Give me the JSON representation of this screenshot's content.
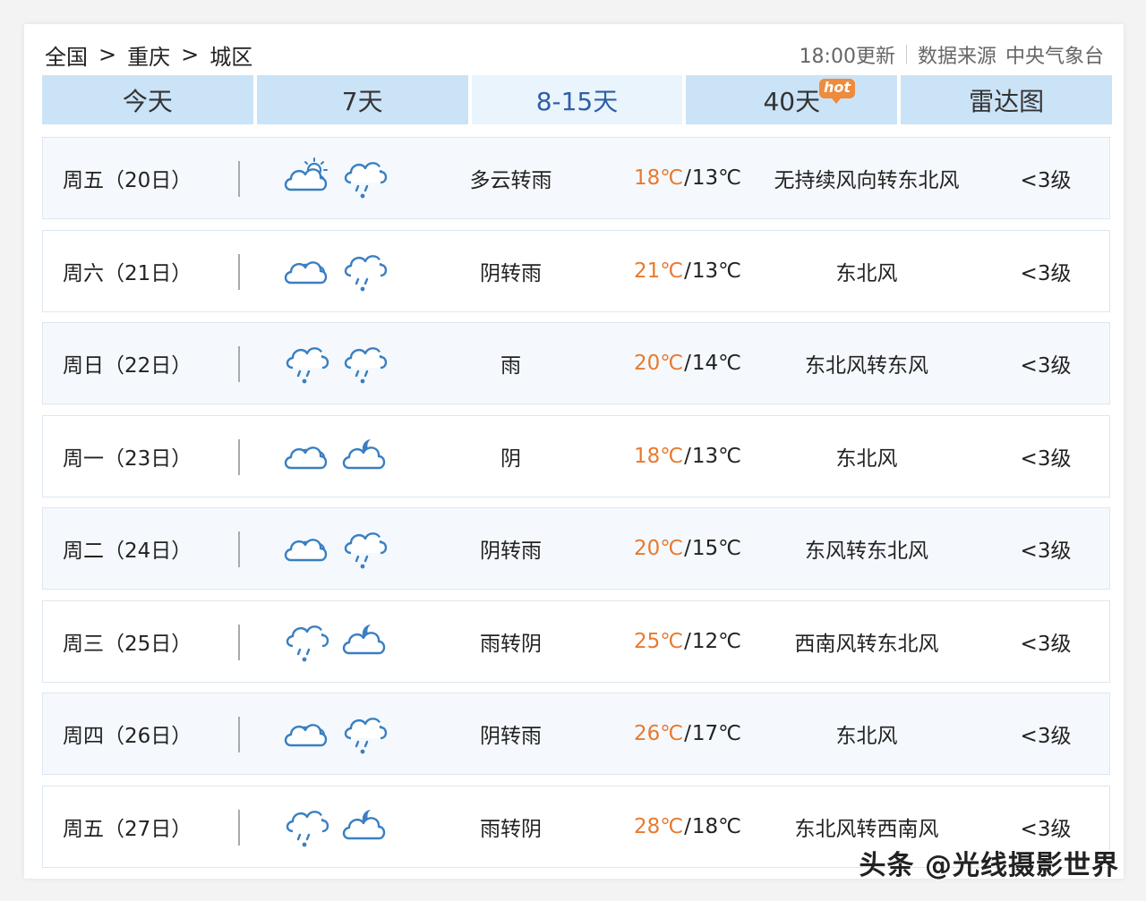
{
  "breadcrumb": {
    "items": [
      "全国",
      "重庆",
      "城区"
    ],
    "separator": ">"
  },
  "update": {
    "time": "18:00更新",
    "source_label": "数据来源",
    "source": "中央气象台"
  },
  "tabs": [
    {
      "label": "今天"
    },
    {
      "label": "7天"
    },
    {
      "label": "8-15天",
      "active": true
    },
    {
      "label": "40天",
      "badge": "hot"
    },
    {
      "label": "雷达图"
    }
  ],
  "forecast": [
    {
      "day": "周五（20日）",
      "icon_day": "partly-cloudy-sun",
      "icon_night": "cloud-rain",
      "desc": "多云转雨",
      "high": "18℃",
      "low": "13℃",
      "wind": "无持续风向转东北风",
      "level": "<3级"
    },
    {
      "day": "周六（21日）",
      "icon_day": "overcast",
      "icon_night": "cloud-rain",
      "desc": "阴转雨",
      "high": "21℃",
      "low": "13℃",
      "wind": "东北风",
      "level": "<3级"
    },
    {
      "day": "周日（22日）",
      "icon_day": "cloud-rain",
      "icon_night": "cloud-rain",
      "desc": "雨",
      "high": "20℃",
      "low": "14℃",
      "wind": "东北风转东风",
      "level": "<3级"
    },
    {
      "day": "周一（23日）",
      "icon_day": "overcast",
      "icon_night": "cloud-moon",
      "desc": "阴",
      "high": "18℃",
      "low": "13℃",
      "wind": "东北风",
      "level": "<3级"
    },
    {
      "day": "周二（24日）",
      "icon_day": "overcast",
      "icon_night": "cloud-rain",
      "desc": "阴转雨",
      "high": "20℃",
      "low": "15℃",
      "wind": "东风转东北风",
      "level": "<3级"
    },
    {
      "day": "周三（25日）",
      "icon_day": "cloud-rain",
      "icon_night": "cloud-moon",
      "desc": "雨转阴",
      "high": "25℃",
      "low": "12℃",
      "wind": "西南风转东北风",
      "level": "<3级"
    },
    {
      "day": "周四（26日）",
      "icon_day": "overcast",
      "icon_night": "cloud-rain",
      "desc": "阴转雨",
      "high": "26℃",
      "low": "17℃",
      "wind": "东北风",
      "level": "<3级"
    },
    {
      "day": "周五（27日）",
      "icon_day": "cloud-rain",
      "icon_night": "cloud-moon",
      "desc": "雨转阴",
      "high": "28℃",
      "low": "18℃",
      "wind": "东北风转西南风",
      "level": "<3级"
    }
  ],
  "watermark": "头条 @光线摄影世界",
  "colors": {
    "tab_bg": "#cbe3f7",
    "tab_active_bg": "#e9f4fd",
    "tab_active_text": "#2f5ea6",
    "high_temp": "#e8792f",
    "hot_badge": "#ef8b3d",
    "icon": "#3a7fc1"
  }
}
